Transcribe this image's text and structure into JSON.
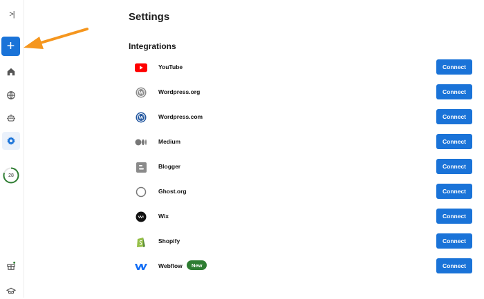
{
  "page": {
    "title": "Settings",
    "section": "Integrations"
  },
  "sidebar": {
    "collapse_label": ">|",
    "new_label": "+",
    "items": [
      "home-icon",
      "globe-icon",
      "robot-icon",
      "settings-icon"
    ],
    "progress_value": "28",
    "progress_fraction": 0.8
  },
  "integrations": [
    {
      "name": "YouTube",
      "button": "Connect",
      "icon": "youtube-icon"
    },
    {
      "name": "Wordpress.org",
      "button": "Connect",
      "icon": "wordpress-org-icon"
    },
    {
      "name": "Wordpress.com",
      "button": "Connect",
      "icon": "wordpress-com-icon"
    },
    {
      "name": "Medium",
      "button": "Connect",
      "icon": "medium-icon"
    },
    {
      "name": "Blogger",
      "button": "Connect",
      "icon": "blogger-icon"
    },
    {
      "name": "Ghost.org",
      "button": "Connect",
      "icon": "ghost-icon"
    },
    {
      "name": "Wix",
      "button": "Connect",
      "icon": "wix-icon"
    },
    {
      "name": "Shopify",
      "button": "Connect",
      "icon": "shopify-icon"
    },
    {
      "name": "Webflow",
      "button": "Connect",
      "icon": "webflow-icon",
      "badge": "New"
    }
  ],
  "colors": {
    "accent": "#1a73d8",
    "badge": "#2e7d32",
    "arrow": "#f5961e"
  }
}
